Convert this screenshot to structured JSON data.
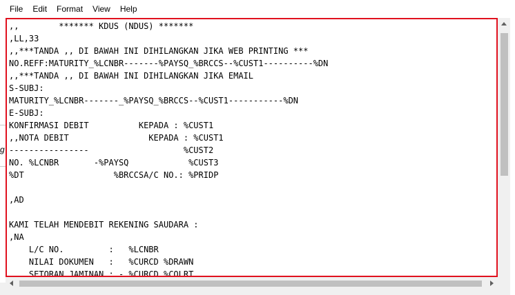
{
  "menu": {
    "file": "File",
    "edit": "Edit",
    "format": "Format",
    "view": "View",
    "help": "Help"
  },
  "side_glyph": "g",
  "editor": {
    "lines": [
      ",,        ******* KDUS (NDUS) *******",
      ",LL,33",
      ",,***TANDA ,, DI BAWAH INI DIHILANGKAN JIKA WEB PRINTING ***",
      "NO.REFF:MATURITY_%LCNBR-------%PAYSQ_%BRCCS--%CUST1----------%DN",
      ",,***TANDA ,, DI BAWAH INI DIHILANGKAN JIKA EMAIL",
      "S-SUBJ:",
      "MATURITY_%LCNBR-------_%PAYSQ_%BRCCS--%CUST1-----------%DN",
      "E-SUBJ:",
      "KONFIRMASI DEBIT          KEPADA : %CUST1",
      ",,NOTA DEBIT                KEPADA : %CUST1",
      "----------------                   %CUST2",
      "NO. %LCNBR       -%PAYSQ            %CUST3",
      "%DT                  %BRCCSA/C NO.: %PRIDP",
      "",
      ",AD",
      "",
      "KAMI TELAH MENDEBIT REKENING SAUDARA :",
      ",NA",
      "    L/C NO.         :   %LCNBR",
      "    NILAI DOKUMEN   :   %CURCD %DRAWN",
      "    SETORAN JAMINAN : - %CURCD %COLRT"
    ]
  }
}
